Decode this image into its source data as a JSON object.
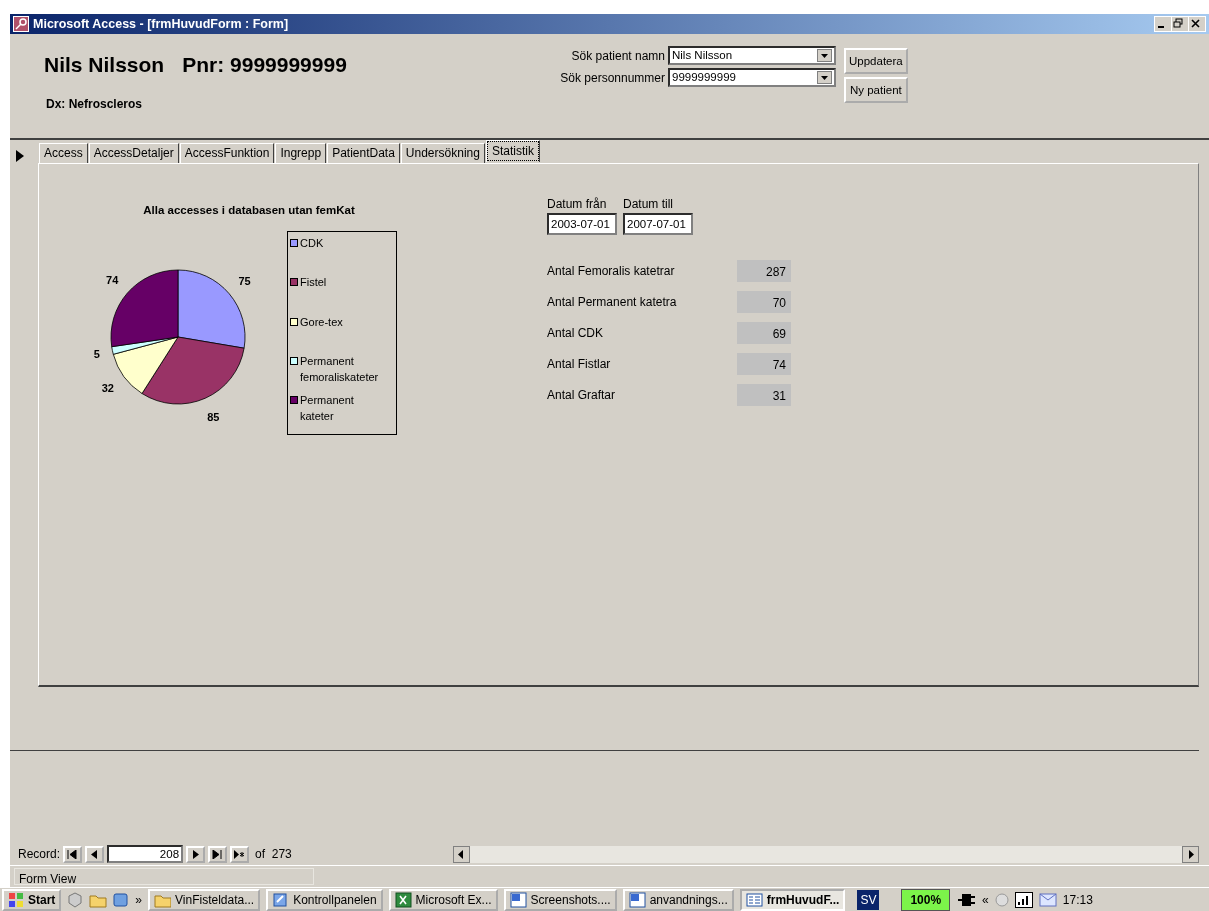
{
  "window": {
    "title": "Microsoft Access - [frmHuvudForm : Form]"
  },
  "header": {
    "patient_name": "Nils Nilsson",
    "pnr": "Pnr: 9999999999",
    "dx": "Dx: Nefroscleros",
    "search": [
      {
        "label": "Sök patient namn",
        "value": "Nils Nilsson"
      },
      {
        "label": "Sök personnummer",
        "value": "9999999999"
      }
    ],
    "buttons": [
      "Uppdatera",
      "Ny patient"
    ]
  },
  "tabs": [
    {
      "label": "Access",
      "selected": false
    },
    {
      "label": "AccessDetaljer",
      "selected": false
    },
    {
      "label": "AccessFunktion",
      "selected": false
    },
    {
      "label": "Ingrepp",
      "selected": false
    },
    {
      "label": "PatientData",
      "selected": false
    },
    {
      "label": "Undersökning",
      "selected": false
    },
    {
      "label": "Statistik",
      "selected": true
    }
  ],
  "statistics": {
    "chart_data": {
      "type": "pie",
      "title": "Alla accesses i databasen utan femKat",
      "data_labels": true,
      "categories": [
        "CDK",
        "Fistel",
        "Gore-tex",
        "Permanent femoraliskateter",
        "Permanent kateter"
      ],
      "values": [
        75,
        85,
        32,
        5,
        74
      ],
      "legend": "right",
      "colors": [
        "#9999ff",
        "#993366",
        "#ffffcc",
        "#ccffff",
        "#660066"
      ]
    },
    "date_from": {
      "label": "Datum från",
      "value": "2003-07-01"
    },
    "date_to": {
      "label": "Datum till",
      "value": "2007-07-01"
    },
    "counts": [
      {
        "label": "Antal Femoralis katetrar",
        "value": "287"
      },
      {
        "label": "Antal Permanent katetra",
        "value": "70"
      },
      {
        "label": "Antal CDK",
        "value": "69"
      },
      {
        "label": "Antal Fistlar",
        "value": "74"
      },
      {
        "label": "Antal Graftar",
        "value": "31"
      }
    ]
  },
  "record_nav": {
    "label": "Record:",
    "current": "208",
    "total": "of  273"
  },
  "status_bar": {
    "text": "Form View"
  },
  "taskbar": {
    "start": "Start",
    "more": "»",
    "tasks": [
      {
        "kind": "folder",
        "label": "VinFisteldata...",
        "selected": false
      },
      {
        "kind": "control-panel",
        "label": "Kontrollpanelen",
        "selected": false
      },
      {
        "kind": "excel",
        "label": "Microsoft Ex...",
        "selected": false
      },
      {
        "kind": "word",
        "label": "Screenshots....",
        "selected": false
      },
      {
        "kind": "word",
        "label": "anvandnings...",
        "selected": false
      },
      {
        "kind": "form",
        "label": "frmHuvudF...",
        "selected": true
      }
    ],
    "language": "SV",
    "battery": "100%",
    "tray_toggle": "«",
    "clock": "17:13"
  }
}
